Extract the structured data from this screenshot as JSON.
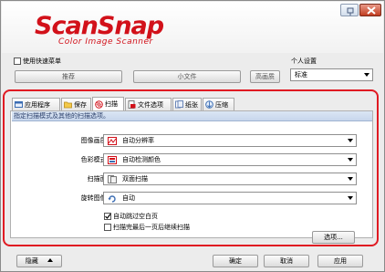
{
  "logo": {
    "main": "ScanSnap",
    "sub": "Color Image Scanner"
  },
  "quick_menu": {
    "label": "使用快速菜单",
    "checked": false
  },
  "profile_buttons": [
    "推荐",
    "小文件",
    "高画质"
  ],
  "personal": {
    "label": "个人设置",
    "value": "标准"
  },
  "tabs": [
    {
      "label": "应用程序",
      "icon": "application-icon"
    },
    {
      "label": "保存",
      "icon": "folder-icon"
    },
    {
      "label": "扫描",
      "icon": "scan-icon"
    },
    {
      "label": "文件选项",
      "icon": "file-option-icon"
    },
    {
      "label": "纸张",
      "icon": "paper-icon"
    },
    {
      "label": "压缩",
      "icon": "compression-icon"
    }
  ],
  "active_tab": "扫描",
  "description": "指定扫描模式及其他的扫描选项。",
  "settings": [
    {
      "label": "图像画质:",
      "value": "自动分辨率",
      "icon": "image-quality-icon"
    },
    {
      "label": "色彩模式:",
      "value": "自动检测颜色",
      "icon": "color-mode-icon"
    },
    {
      "label": "扫描面:",
      "value": "双面扫描",
      "icon": "duplex-icon"
    },
    {
      "label": "旋转图像:",
      "value": "自动",
      "icon": "rotate-icon"
    }
  ],
  "options": [
    {
      "label": "自动跳过空白页",
      "checked": true
    },
    {
      "label": "扫描完最后一页后继续扫描",
      "checked": false
    }
  ],
  "options_button": "选项...",
  "footer": {
    "hide": "隐藏",
    "ok": "确定",
    "cancel": "取消",
    "apply": "应用"
  },
  "colors": {
    "brand_red": "#d2111a",
    "frame_red": "#e01a22"
  }
}
